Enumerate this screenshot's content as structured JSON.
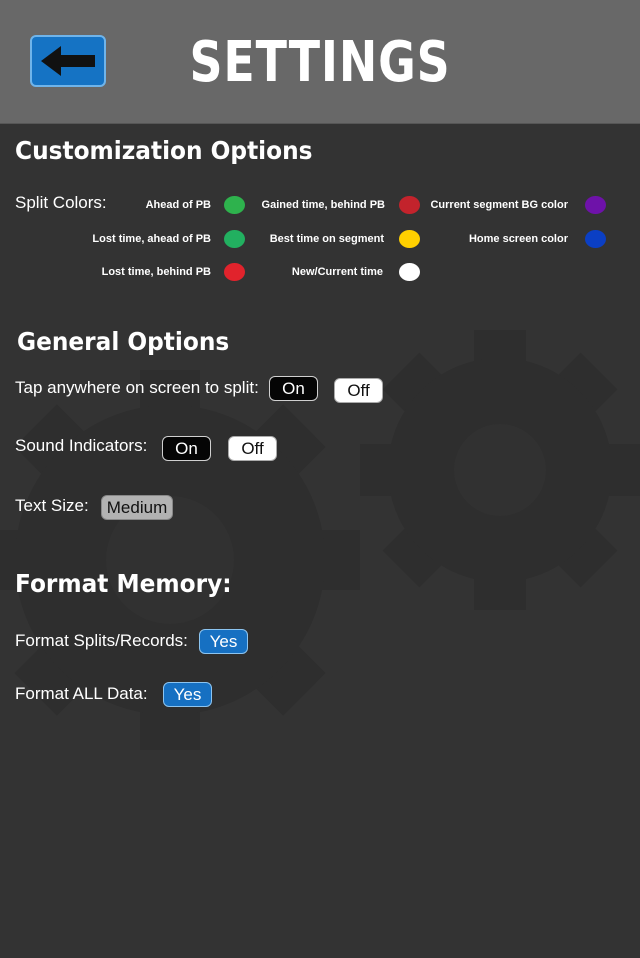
{
  "header": {
    "title": "SETTINGS",
    "back_icon": "back-arrow-icon"
  },
  "customization": {
    "title": "Customization Options",
    "split_colors_label": "Split Colors:",
    "swatches": [
      {
        "label": "Ahead of PB",
        "color": "#2eb24d"
      },
      {
        "label": "Lost time, ahead of PB",
        "color": "#22b060"
      },
      {
        "label": "Lost time, behind PB",
        "color": "#e1232c"
      },
      {
        "label": "Gained time, behind PB",
        "color": "#c3232c"
      },
      {
        "label": "Best time on segment",
        "color": "#ffd000"
      },
      {
        "label": "New/Current time",
        "color": "#ffffff"
      },
      {
        "label": "Current segment BG color",
        "color": "#6e12a9"
      },
      {
        "label": "Home screen color",
        "color": "#0b3fc4"
      }
    ]
  },
  "general": {
    "title": "General Options",
    "tap_label": "Tap anywhere on screen to split:",
    "sound_label": "Sound Indicators:",
    "text_size_label": "Text Size:",
    "on_label": "On",
    "off_label": "Off",
    "text_size_value": "Medium"
  },
  "format": {
    "title": "Format Memory:",
    "splits_label": "Format Splits/Records:",
    "all_label": "Format ALL Data:",
    "yes_label": "Yes"
  },
  "colors": {
    "background": "#333333",
    "header": "#686868",
    "accent": "#1670c2"
  }
}
